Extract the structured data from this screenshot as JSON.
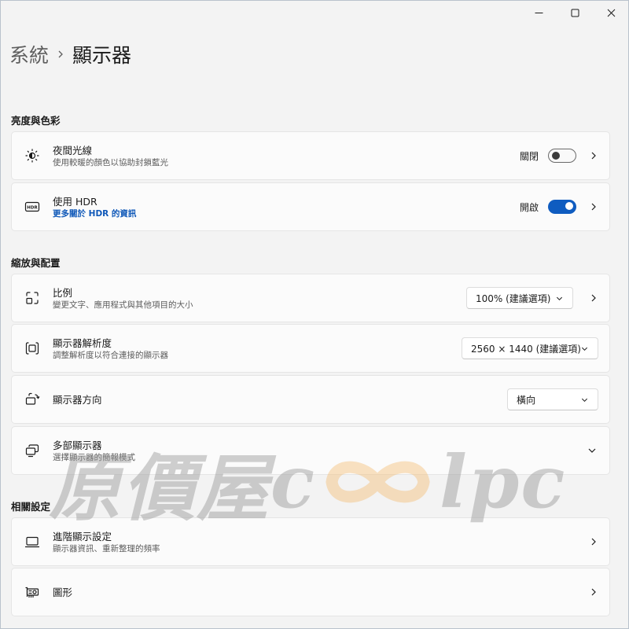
{
  "breadcrumb": {
    "parent": "系統",
    "current": "顯示器"
  },
  "sections": {
    "brightness": "亮度與色彩",
    "scale_layout": "縮放與配置",
    "related": "相關設定"
  },
  "night_light": {
    "title": "夜間光線",
    "subtitle": "使用較暖的顏色以協助封鎖藍光",
    "state": "關閉"
  },
  "hdr": {
    "title": "使用 HDR",
    "link": "更多關於 HDR 的資訊",
    "state": "開啟"
  },
  "scale": {
    "title": "比例",
    "subtitle": "變更文字、應用程式與其他項目的大小",
    "value": "100% (建議選項)"
  },
  "resolution": {
    "title": "顯示器解析度",
    "subtitle": "調整解析度以符合連接的顯示器",
    "value": "2560 × 1440 (建議選項)"
  },
  "orientation": {
    "title": "顯示器方向",
    "value": "橫向"
  },
  "multiple": {
    "title": "多部顯示器",
    "subtitle": "選擇顯示器的簡報模式"
  },
  "advanced": {
    "title": "進階顯示設定",
    "subtitle": "顯示器資訊、重新整理的頻率"
  },
  "graphics": {
    "title": "圖形"
  },
  "watermark": {
    "left": "原價屋",
    "c": "c",
    "right": "lpc"
  },
  "colors": {
    "accent": "#0f5cc0",
    "link": "#0f58b8",
    "background": "#f3f3f3",
    "card": "#fbfbfb"
  }
}
